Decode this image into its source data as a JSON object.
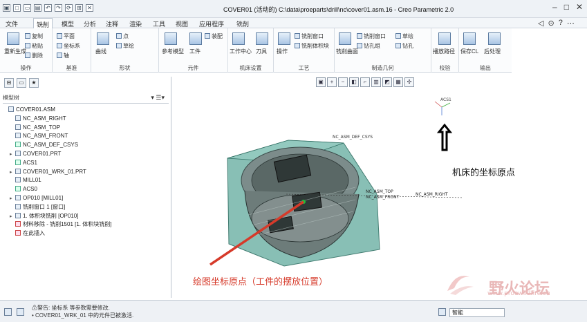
{
  "window": {
    "title": "COVER01 (活动的) C:\\data\\proeparts\\drill\\nc\\cover01.asm.16 - Creo Parametric 2.0"
  },
  "menu": {
    "file": "文件",
    "tabs": [
      "铣削",
      "模型",
      "分析",
      "注释",
      "渲染",
      "工具",
      "视图",
      "应用程序",
      "铣削"
    ]
  },
  "ribbon": {
    "groups": [
      {
        "label": "操作",
        "items": [
          "重新生成",
          "复制",
          "粘贴",
          "删除"
        ]
      },
      {
        "label": "基准",
        "items": [
          "平面",
          "坐标系",
          "轴"
        ]
      },
      {
        "label": "形状",
        "items": [
          "曲线",
          "点",
          "草绘"
        ]
      },
      {
        "label": "元件",
        "items": [
          "参考模型",
          "工件",
          "装配"
        ]
      },
      {
        "label": "机床设置",
        "items": [
          "工作中心",
          "刀具"
        ]
      },
      {
        "label": "工艺",
        "items": [
          "操作",
          "铣削窗口",
          "铣削体积块"
        ]
      },
      {
        "label": "制造几何",
        "items": [
          "铣削曲面",
          "铣削窗口",
          "钻孔组",
          "草绘",
          "钻孔"
        ]
      },
      {
        "label": "校验",
        "items": [
          "播放路径"
        ]
      },
      {
        "label": "输出",
        "items": [
          "保存CL",
          "后处理"
        ]
      }
    ]
  },
  "left_panel": {
    "tree_title": "模型树",
    "items": [
      {
        "label": "COVER01.ASM",
        "level": 0,
        "expand": "",
        "icon": "asm"
      },
      {
        "label": "NC_ASM_RIGHT",
        "level": 1,
        "expand": "",
        "icon": "plane"
      },
      {
        "label": "NC_ASM_TOP",
        "level": 1,
        "expand": "",
        "icon": "plane"
      },
      {
        "label": "NC_ASM_FRONT",
        "level": 1,
        "expand": "",
        "icon": "plane"
      },
      {
        "label": "NC_ASM_DEF_CSYS",
        "level": 1,
        "expand": "",
        "icon": "csys"
      },
      {
        "label": "COVER01.PRT",
        "level": 1,
        "expand": "▸",
        "icon": "part"
      },
      {
        "label": "ACS1",
        "level": 1,
        "expand": "",
        "icon": "csys"
      },
      {
        "label": "COVER01_WRK_01.PRT",
        "level": 1,
        "expand": "▸",
        "icon": "part"
      },
      {
        "label": "MILL01",
        "level": 1,
        "expand": "",
        "icon": "mill"
      },
      {
        "label": "ACS0",
        "level": 1,
        "expand": "",
        "icon": "csys"
      },
      {
        "label": "OP010 [MILL01]",
        "level": 1,
        "expand": "▸",
        "icon": "op"
      },
      {
        "label": "铣削窗口 1 [窗口]",
        "level": 1,
        "expand": "",
        "icon": "win"
      },
      {
        "label": "1. 体积块铣削 [OP010]",
        "level": 1,
        "expand": "▸",
        "icon": "seq"
      },
      {
        "label": "材料移除 - 铣削1501 [1. 体积块铣削]",
        "level": 1,
        "expand": "",
        "icon": "rem"
      },
      {
        "label": "在此插入",
        "level": 1,
        "expand": "",
        "icon": "insert"
      }
    ]
  },
  "canvas": {
    "wcs_label": "NC_ASM_DEF_CSYS",
    "small_label": "ACS1",
    "coord_line1": "NC_ASM_TOP",
    "coord_line2": "NC_ASM_FRONT",
    "coord_line3": "NC_ASM_RIGHT",
    "annotation_machine": "机床的坐标原点",
    "annotation_drawing": "绘图坐标原点（工件的摆放位置）",
    "red": "#d63a2a",
    "accent": "#3a8a7a"
  },
  "status": {
    "line1": "⚠警告: 坐标系 等参数需要修改.",
    "line2": "• COVER01_WRK_01 中的元件已被激活.",
    "filter": "智能"
  },
  "watermark": {
    "text": "野火论坛",
    "url": "www.proewildfire.cn"
  }
}
